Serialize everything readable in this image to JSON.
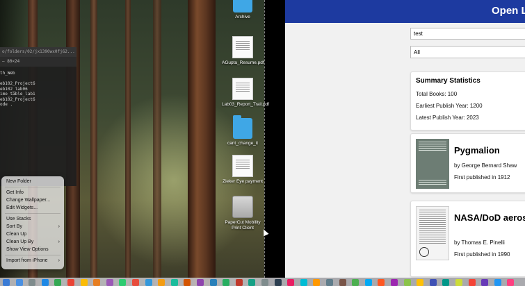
{
  "terminal": {
    "title": "o/folders/02/jx1390wx0fj62...",
    "subtitle": "— 80×24",
    "lines": [
      "th_Web",
      "",
      "eb102_Project6",
      "eb102_lab06",
      "ime_table_lab1",
      "eb102_Project6",
      "ode ."
    ]
  },
  "context_menu": {
    "items": [
      {
        "label": "New Folder",
        "submenu": false
      },
      {
        "sep": true
      },
      {
        "label": "Get Info",
        "submenu": false
      },
      {
        "label": "Change Wallpaper...",
        "submenu": false
      },
      {
        "label": "Edit Widgets...",
        "submenu": false
      },
      {
        "sep": true
      },
      {
        "label": "Use Stacks",
        "submenu": false
      },
      {
        "label": "Sort By",
        "submenu": true
      },
      {
        "label": "Clean Up",
        "submenu": false
      },
      {
        "label": "Clean Up By",
        "submenu": true
      },
      {
        "label": "Show View Options",
        "submenu": false
      },
      {
        "sep": true
      },
      {
        "label": "Import from iPhone",
        "submenu": true
      }
    ]
  },
  "desktop_icons": [
    {
      "label": "Archive",
      "kind": "folder"
    },
    {
      "label": "AGupta_Resume.pdf",
      "kind": "pdf"
    },
    {
      "label": "Lab03_Report_Trail.pdf",
      "kind": "pdf"
    },
    {
      "label": "cant_change_it",
      "kind": "folder"
    },
    {
      "label": "Zieker Eye payment",
      "kind": "pdf"
    },
    {
      "label": "PaperCut Mobility Print Client",
      "kind": "app"
    }
  ],
  "app": {
    "title": "Open Library",
    "search_value": "test",
    "filter_value": "All",
    "stats": {
      "title": "Summary Statistics",
      "total_books": "Total Books: 100",
      "earliest": "Earliest Publish Year: 1200",
      "latest": "Latest Publish Year: 2023"
    },
    "books": [
      {
        "title": "Pygmalion",
        "author": "by George Bernard Shaw",
        "published": "First published in 1912",
        "cover_color": "#6d7d74"
      },
      {
        "title": "NASA/DoD aerospace knowledge diffusion research project",
        "author": "by Thomas E. Pinelli",
        "published": "First published in 1990",
        "cover_color": "#f4f4f4"
      }
    ]
  },
  "dock": {
    "icon_colors": [
      "#3a7bd5",
      "#4a90e2",
      "#7f8c8d",
      "#1e88e5",
      "#34a853",
      "#ea4335",
      "#fbbc05",
      "#e67e22",
      "#9b59b6",
      "#2ecc71",
      "#e74c3c",
      "#3498db",
      "#f39c12",
      "#1abc9c",
      "#d35400",
      "#8e44ad",
      "#2980b9",
      "#27ae60",
      "#c0392b",
      "#16a085",
      "#7f8c8d",
      "#2c3e50",
      "#e91e63",
      "#00bcd4",
      "#ff9800",
      "#607d8b",
      "#795548",
      "#4caf50",
      "#03a9f4",
      "#ff5722",
      "#9c27b0",
      "#8bc34a",
      "#ffc107",
      "#3f51b5",
      "#009688",
      "#cddc39",
      "#f44336",
      "#673ab7",
      "#2196f3",
      "#ff4081"
    ]
  }
}
